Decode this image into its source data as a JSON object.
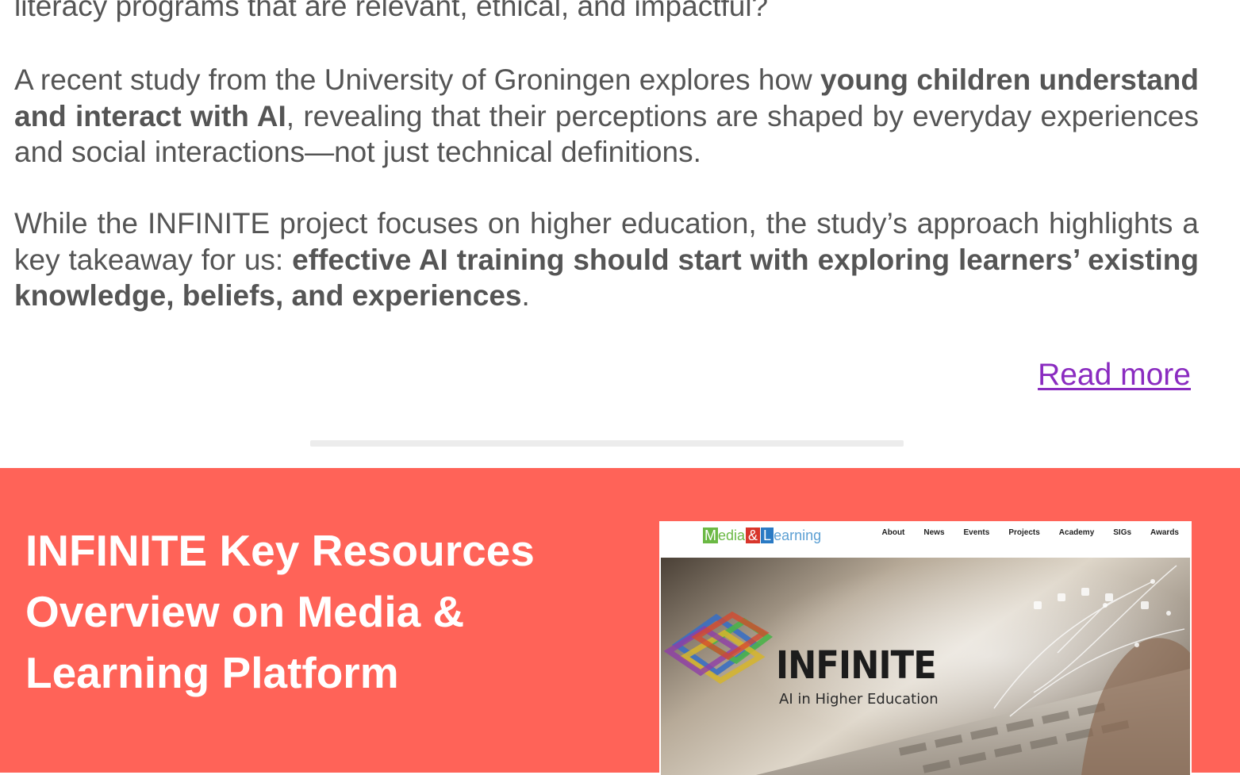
{
  "article": {
    "p0": {
      "t1": "literacy programs that are relevant, ethical, and impactful?"
    },
    "p1": {
      "t1": "A recent study from the University of Groningen explores how ",
      "b1": "young children understand and interact with AI",
      "t2": ", revealing that their perceptions are shaped by everyday experiences and social interactions—not just technical definitions."
    },
    "p2": {
      "t1": "While the INFINITE project focuses on higher education, the study’s approach highlights a key takeaway for us: ",
      "b1": "effective AI training should start with exploring learners’ existing knowledge, beliefs, and experiences",
      "t2": "."
    },
    "read_more": "Read more"
  },
  "resources": {
    "title": "INFINITE Key Resources Overview on Media & Learning Platform",
    "image": {
      "logo": {
        "m_letter": "M",
        "m_rest": "edia",
        "amp": "&",
        "l_letter": "L",
        "l_rest": "earning"
      },
      "menu": [
        "About",
        "News",
        "Events",
        "Projects",
        "Academy",
        "SIGs",
        "Awards"
      ],
      "hero_title": "INFINITE",
      "hero_subtitle": "AI in Higher Education"
    }
  },
  "colors": {
    "body_text": "#555555",
    "link": "#8a2bc0",
    "divider": "#ececec",
    "section_bg": "#ff6358",
    "section_title": "#ffffff"
  }
}
